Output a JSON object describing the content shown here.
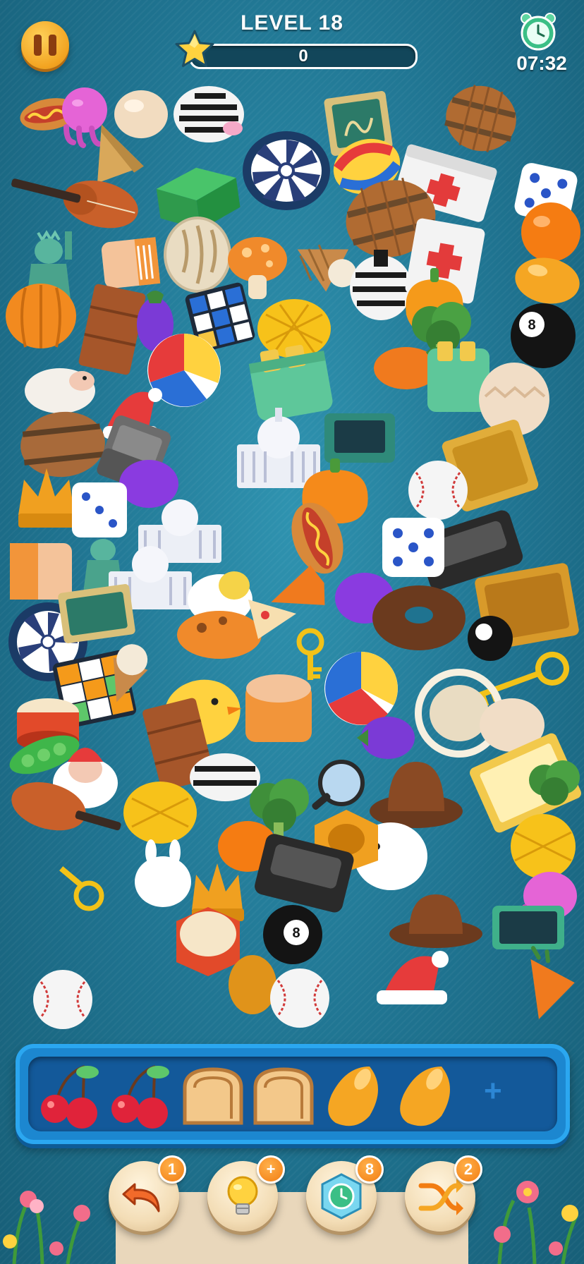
{
  "header": {
    "level_label": "LEVEL 18",
    "score": "0",
    "score_progress": 0,
    "timer": "07:32"
  },
  "colors": {
    "background": "#1f7390",
    "tray": "#1c87d0",
    "badge": "#f27d12",
    "pause": "#f2a320"
  },
  "field_items": [
    "hotdog",
    "octopus",
    "ice-cream",
    "zebra",
    "cheese",
    "barrel",
    "dartboard",
    "ticket",
    "beach-ball",
    "first-aid-kit",
    "dice",
    "violin",
    "green-cube",
    "orange",
    "statue-of-liberty",
    "ice-cream-cone",
    "mushroom",
    "cupcake",
    "pumpkin",
    "wooden-chair",
    "rubiks-cube",
    "pineapple",
    "billiard-ball",
    "bell-pepper",
    "sheep",
    "beach-ball",
    "toaster",
    "carrot",
    "santa-hat",
    "broccoli",
    "capitol-building",
    "crown",
    "baseball",
    "sofa",
    "mango",
    "donut",
    "key",
    "eggplant",
    "magnifying-glass",
    "cowboy-hat",
    "duck",
    "rabbit",
    "smartphone",
    "pea-pod",
    "pizza"
  ],
  "tray": {
    "slots": [
      {
        "item": "cherry"
      },
      {
        "item": "cherry"
      },
      {
        "item": "bread"
      },
      {
        "item": "bread"
      },
      {
        "item": "mango"
      },
      {
        "item": "mango"
      }
    ],
    "empty_slot_symbol": "+"
  },
  "boosters": [
    {
      "name": "undo",
      "icon": "undo-arrow-icon",
      "count": "1"
    },
    {
      "name": "hint",
      "icon": "lightbulb-icon",
      "count": "+"
    },
    {
      "name": "freeze",
      "icon": "freeze-clock-icon",
      "count": "8"
    },
    {
      "name": "shuffle",
      "icon": "shuffle-icon",
      "count": "2"
    }
  ]
}
